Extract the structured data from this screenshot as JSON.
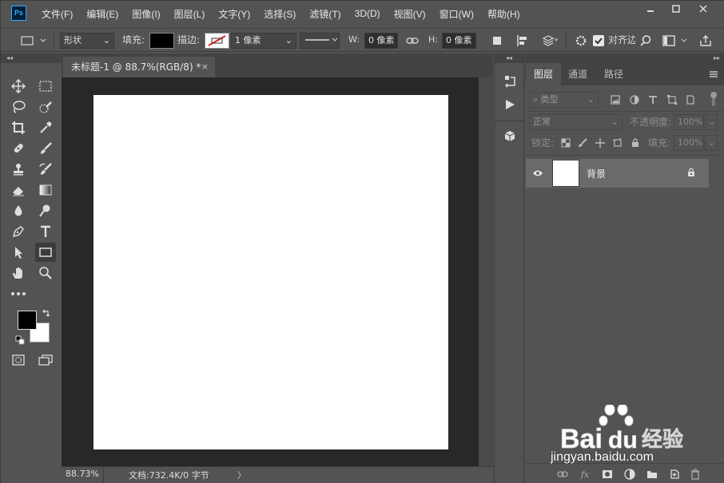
{
  "app": {
    "logo": "Ps"
  },
  "menu": [
    "文件(F)",
    "编辑(E)",
    "图像(I)",
    "图层(L)",
    "文字(Y)",
    "选择(S)",
    "滤镜(T)",
    "3D(D)",
    "视图(V)",
    "窗口(W)",
    "帮助(H)"
  ],
  "options": {
    "mode": "形状",
    "fill_label": "填充:",
    "stroke_label": "描边:",
    "stroke_width": "1 像素",
    "w_label": "W:",
    "w_value": "0 像素",
    "h_label": "H:",
    "h_value": "0 像素",
    "align_edges_label": "对齐边缘",
    "align_edges_checked": true
  },
  "document": {
    "tab_title": "未标题-1 @ 88.7%(RGB/8) *",
    "tab_close": "×"
  },
  "status": {
    "zoom": "88.73%",
    "doc_info": "文档:732.4K/0 字节",
    "arrow": "〉"
  },
  "layers_panel": {
    "tabs": [
      "图层",
      "通道",
      "路径"
    ],
    "filter_kind": "类型",
    "blend_mode": "正常",
    "opacity_label": "不透明度:",
    "opacity_value": "100%",
    "lock_label": "锁定:",
    "fill_label": "填充:",
    "fill_value": "100%",
    "layers": [
      {
        "name": "背景",
        "visible": true,
        "locked": true
      }
    ]
  },
  "colors": {
    "foreground": "#000000",
    "background": "#ffffff",
    "accent": "#31a8ff",
    "ui": "#535353"
  },
  "watermark": {
    "brand": "Baidu 经验",
    "url": "jingyan.baidu.com"
  }
}
